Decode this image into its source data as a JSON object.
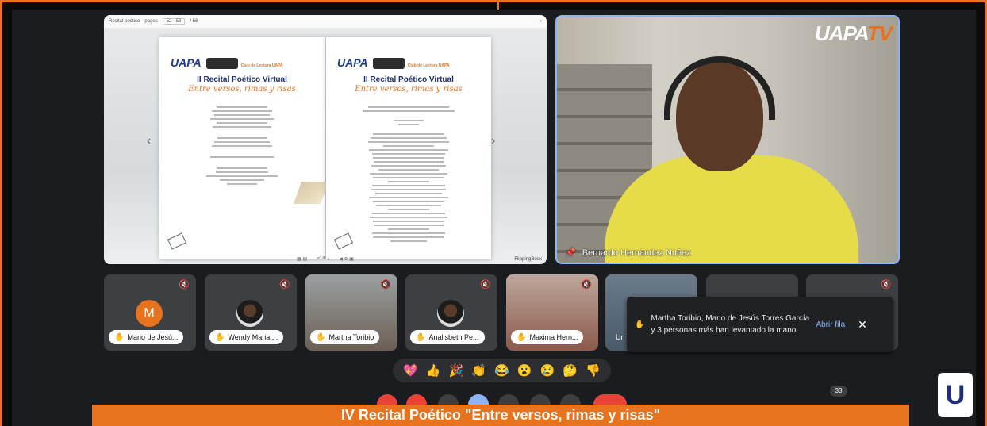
{
  "presentation": {
    "toolbar_title": "Recital poético",
    "pages_label": "pages",
    "page_range": "52 - 53",
    "page_total": "/ 56",
    "logo": "UAPA",
    "club_text": "Club de Lectura UAPA",
    "title": "II Recital Poético Virtual",
    "subtitle": "Entre versos, rimas y risas",
    "flipping_book": "FlippingBook"
  },
  "speaker": {
    "name": "Bernardo Hernández Nuñez",
    "brand": "UAPA",
    "brand_tv": "TV"
  },
  "participants": [
    {
      "name": "Mario de Jesú...",
      "avatar_letter": "M"
    },
    {
      "name": "Wendy Maria ..."
    },
    {
      "name": "Martha Toribio"
    },
    {
      "name": "Analisbeth Pe..."
    },
    {
      "name": "Maxima Hern..."
    },
    {
      "name": "Un"
    }
  ],
  "notification": {
    "text": "Martha Toribio, Mario de Jesús Torres García y 3 personas más han levantado la mano",
    "action": "Abrir fila",
    "close": "✕"
  },
  "reactions": [
    "💖",
    "👍",
    "🎉",
    "👏",
    "😂",
    "😮",
    "😢",
    "🤔",
    "👎"
  ],
  "participant_count": "33",
  "banner": {
    "text": "IV Recital Poético \"Entre versos, rimas y risas\""
  },
  "colors": {
    "accent": "#e8731f",
    "active_speaker_border": "#8ab4f8"
  }
}
